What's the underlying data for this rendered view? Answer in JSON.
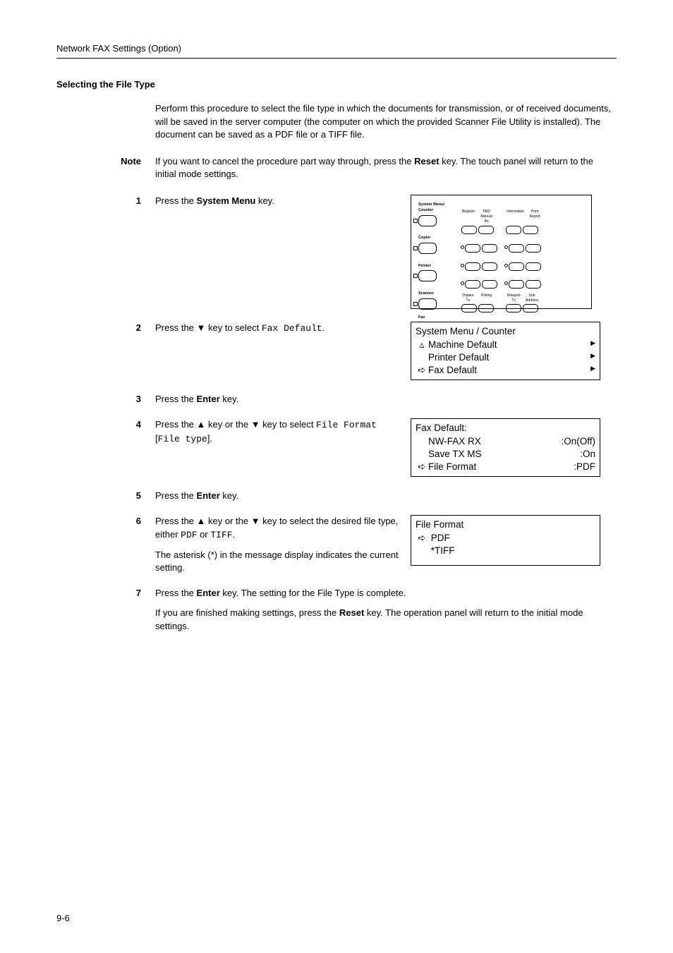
{
  "header": "Network FAX Settings (Option)",
  "section_title": "Selecting the File Type",
  "intro": "Perform this procedure to select the file type in which the documents for transmission, or of received documents, will be saved in the server computer (the computer on which the provided Scanner File Utility is installed). The document can be saved as a PDF file or a TIFF file.",
  "note": {
    "label": "Note",
    "t1": "If you want to cancel the procedure part way through, press the ",
    "bold1": "Reset",
    "t2": " key. The touch panel will return to the initial mode settings."
  },
  "steps": {
    "s1": {
      "n": "1",
      "a": "Press the ",
      "b": "System Menu",
      "c": " key."
    },
    "s2": {
      "n": "2",
      "a": "Press the ▼ key to select ",
      "m": "Fax Default",
      "c": "."
    },
    "s3": {
      "n": "3",
      "a": "Press the ",
      "b": "Enter",
      "c": " key."
    },
    "s4": {
      "n": "4",
      "a": "Press the ▲ key or the ▼ key to select ",
      "m1": "File Format",
      "b1": " [",
      "m2": "File type",
      "b2": "]."
    },
    "s5": {
      "n": "5",
      "a": "Press the ",
      "b": "Enter",
      "c": " key."
    },
    "s6": {
      "n": "6",
      "a": "Press the ▲ key or the ▼ key to select the desired file type, either ",
      "m1": "PDF",
      "mid": " or ",
      "m2": "TIFF",
      "c": ".",
      "p2": "The asterisk (*) in the message display indicates the current setting."
    },
    "s7": {
      "n": "7",
      "a": "Press the ",
      "b": "Enter",
      "c": " key. The setting for the File Type is complete.",
      "p2a": "If you are finished making settings, press the ",
      "p2b": "Reset",
      "p2c": " key. The operation panel will return to the initial mode settings."
    }
  },
  "panel": {
    "tl": "System Menu/\nCounter",
    "copier": "Copier",
    "printer": "Printer",
    "scanner": "Scanner",
    "fax": "Fax",
    "top_labels": [
      "Register",
      "TAD/\nManual Rx",
      "Information",
      "Print\nReport"
    ],
    "bot_labels": [
      "Duplex-\nTx.",
      "Polling",
      "Delayed-\nTx.",
      "Sub\nAddress"
    ]
  },
  "lcd1": {
    "title": "System Menu / Counter",
    "r1": "Machine Default",
    "r2": "Printer Default",
    "r3": "Fax Default"
  },
  "lcd2": {
    "title": "Fax Default:",
    "r1l": "NW-FAX RX",
    "r1r": ":On(Off)",
    "r2l": "Save TX MS",
    "r2r": ":On",
    "r3l": "File Format",
    "r3r": ":PDF"
  },
  "lcd3": {
    "title": "File Format",
    "r1": "PDF",
    "r2": "*TIFF"
  },
  "footer": "9-6"
}
